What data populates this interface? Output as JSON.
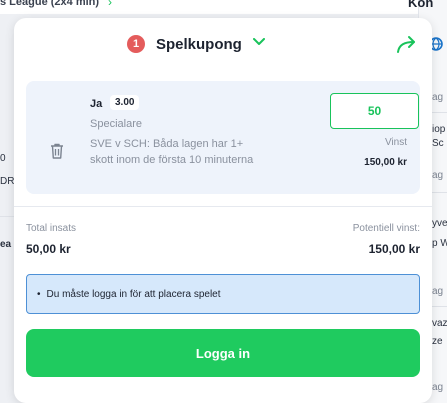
{
  "background": {
    "top_text": "s League (2x4 min)",
    "right_header": "Kon",
    "right_texts": [
      "ag",
      "iop",
      "Sc",
      "ag",
      "yve",
      "p W",
      "ag",
      "vaz",
      "ze",
      "ag"
    ],
    "left_texts": [
      "0",
      "DR)",
      "ea"
    ]
  },
  "betslip": {
    "count": "1",
    "title": "Spelkupong",
    "bet": {
      "selection": "Ja",
      "odds": "3.00",
      "market_type": "Specialare",
      "description": "SVE v SCH: Båda lagen har 1+ skott inom de första 10 minuterna",
      "stake": "50",
      "win_label": "Vinst",
      "win_amount": "150,00 kr"
    },
    "total_stake_label": "Total insats",
    "total_stake_value": "50,00 kr",
    "potential_win_label": "Potentiell vinst:",
    "potential_win_value": "150,00 kr",
    "notice_text": "Du måste logga in för att placera spelet",
    "login_button": "Logga in"
  },
  "colors": {
    "accent_green": "#1fcb5f",
    "badge_red": "#e45c5c",
    "notice_blue": "#d6e8fb"
  }
}
